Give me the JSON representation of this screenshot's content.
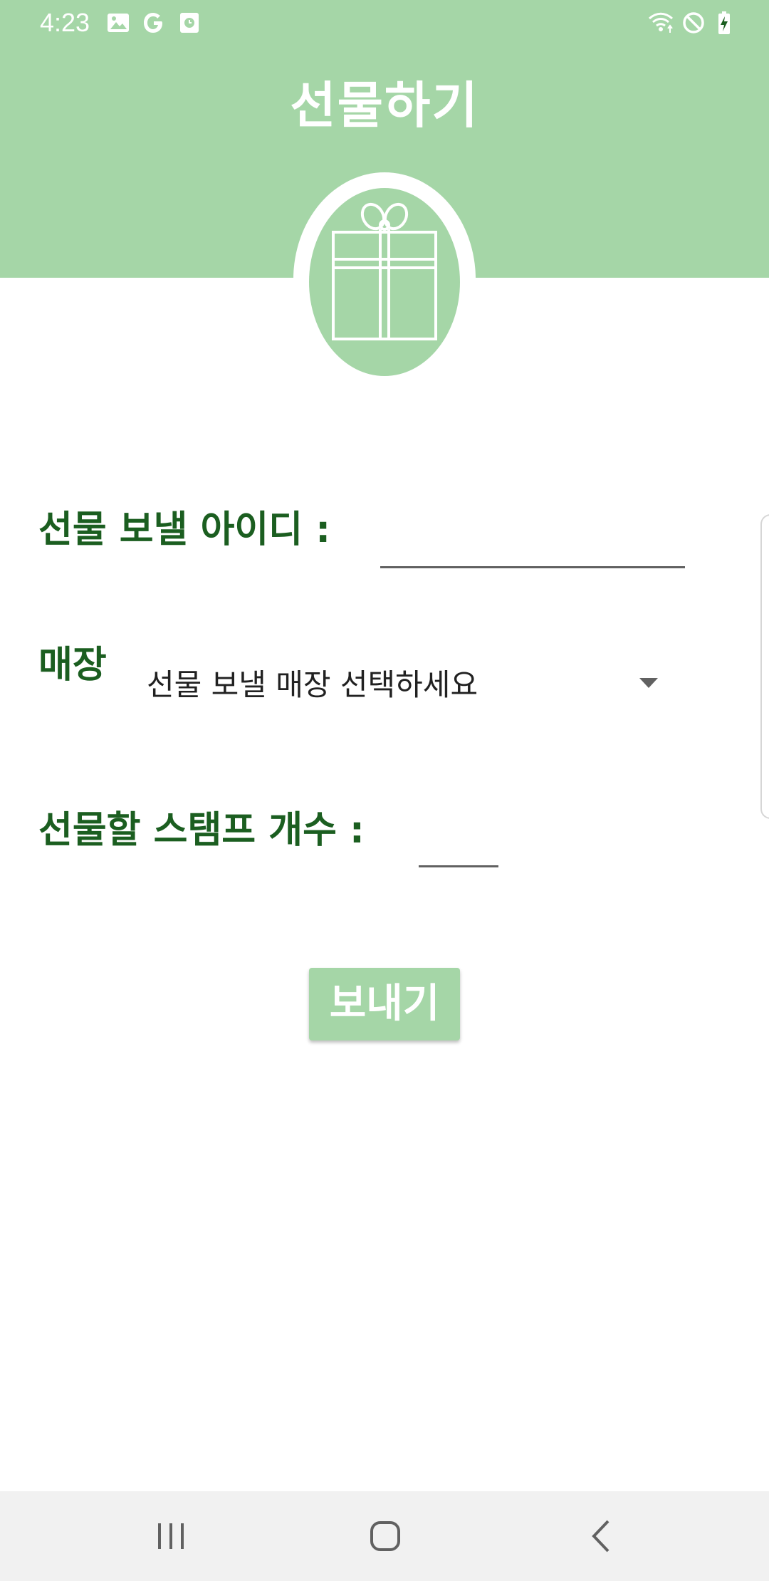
{
  "status_bar": {
    "time": "4:23",
    "left_icons": [
      "gallery-icon",
      "google-icon",
      "clock-app-icon"
    ],
    "right_icons": [
      "wifi-icon",
      "do-not-disturb-icon",
      "battery-charging-icon"
    ]
  },
  "header": {
    "title": "선물하기",
    "badge_icon": "gift-icon"
  },
  "form": {
    "recipient_label": "선물 보낼 아이디 :",
    "recipient_value": "",
    "store_label": "매장",
    "store_selected": "선물 보낼 매장 선택하세요",
    "stamp_count_label": "선물할 스탬프 개수 :",
    "stamp_count_value": ""
  },
  "actions": {
    "send_label": "보내기"
  },
  "nav_bar": {
    "buttons": [
      "recent-apps-icon",
      "home-icon",
      "back-icon"
    ]
  },
  "colors": {
    "header_bg": "#a5d6a7",
    "label_text": "#1b5e20",
    "button_bg": "#a5d6a7",
    "nav_bg": "#f1f1f1"
  }
}
